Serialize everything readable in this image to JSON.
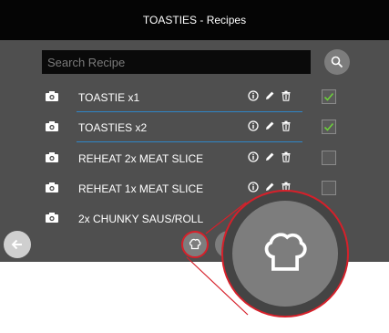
{
  "window": {
    "title": "TOASTIES - Recipes"
  },
  "search": {
    "placeholder": "Search Recipe",
    "icon": "search-icon"
  },
  "recipes": [
    {
      "name": "TOASTIE x1",
      "checked": true
    },
    {
      "name": "TOASTIES x2",
      "checked": true
    },
    {
      "name": "REHEAT 2x MEAT SLICE",
      "checked": false
    },
    {
      "name": "REHEAT 1x MEAT SLICE",
      "checked": false
    },
    {
      "name": "2x CHUNKY SAUS/ROLL",
      "checked": false
    }
  ],
  "icons": {
    "row_icon": "camera-icon",
    "actions": [
      "info-icon",
      "edit-icon",
      "delete-icon"
    ],
    "back": "back-arrow-icon",
    "home": "chef-hat-icon"
  },
  "colors": {
    "title_bar": "#050505",
    "background": "#4f4f4f",
    "separator": "#2f86c8",
    "check": "#6ccf3a",
    "highlight": "#d6202a"
  }
}
